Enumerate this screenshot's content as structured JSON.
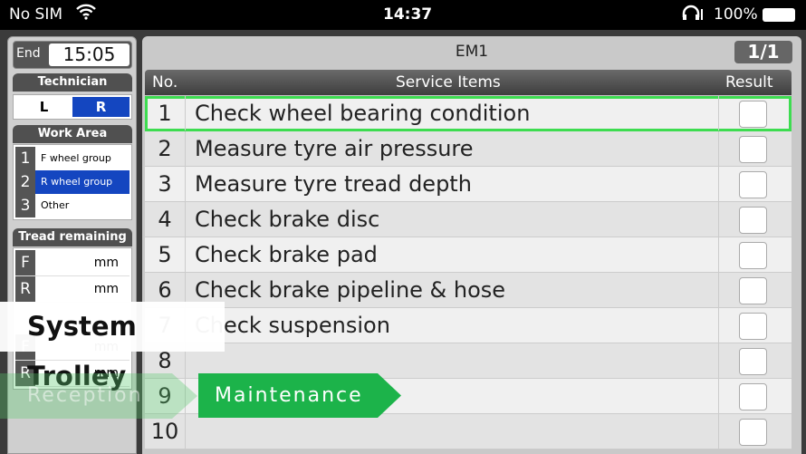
{
  "status_bar": {
    "carrier": "No SIM",
    "time": "14:37",
    "battery": "100%",
    "icons": [
      "wifi-icon",
      "headphones-icon",
      "battery-icon"
    ]
  },
  "left_panel": {
    "end_label": "End",
    "end_time": "15:05",
    "technician": {
      "header": "Technician",
      "options": [
        "L",
        "R"
      ],
      "selected": "R"
    },
    "work_area": {
      "header": "Work Area",
      "items": [
        {
          "no": "1",
          "label": "F wheel group"
        },
        {
          "no": "2",
          "label": "R wheel group",
          "selected": true
        },
        {
          "no": "3",
          "label": "Other"
        }
      ]
    },
    "tread": {
      "header": "Tread remaining",
      "rows": [
        {
          "label": "F",
          "unit": "mm"
        },
        {
          "label": "R",
          "unit": "mm"
        },
        {
          "label": "F",
          "unit": "mm"
        },
        {
          "label": "R",
          "unit": "mm"
        }
      ]
    }
  },
  "main": {
    "title": "EM1",
    "page": "1/1",
    "columns": {
      "no": "No.",
      "items": "Service Items",
      "result": "Result"
    },
    "rows": [
      {
        "no": "1",
        "item": "Check wheel bearing condition"
      },
      {
        "no": "2",
        "item": "Measure tyre air pressure"
      },
      {
        "no": "3",
        "item": "Measure tyre tread depth"
      },
      {
        "no": "4",
        "item": "Check brake disc"
      },
      {
        "no": "5",
        "item": "Check brake pad"
      },
      {
        "no": "6",
        "item": "Check brake pipeline & hose"
      },
      {
        "no": "7",
        "item": "Check suspension"
      },
      {
        "no": "8",
        "item": ""
      },
      {
        "no": "9",
        "item": ""
      },
      {
        "no": "10",
        "item": ""
      }
    ]
  },
  "overlay": {
    "caption": "System Trolley",
    "steps": [
      "Reception",
      "Maintenance"
    ],
    "accent": "#1cb34a"
  }
}
